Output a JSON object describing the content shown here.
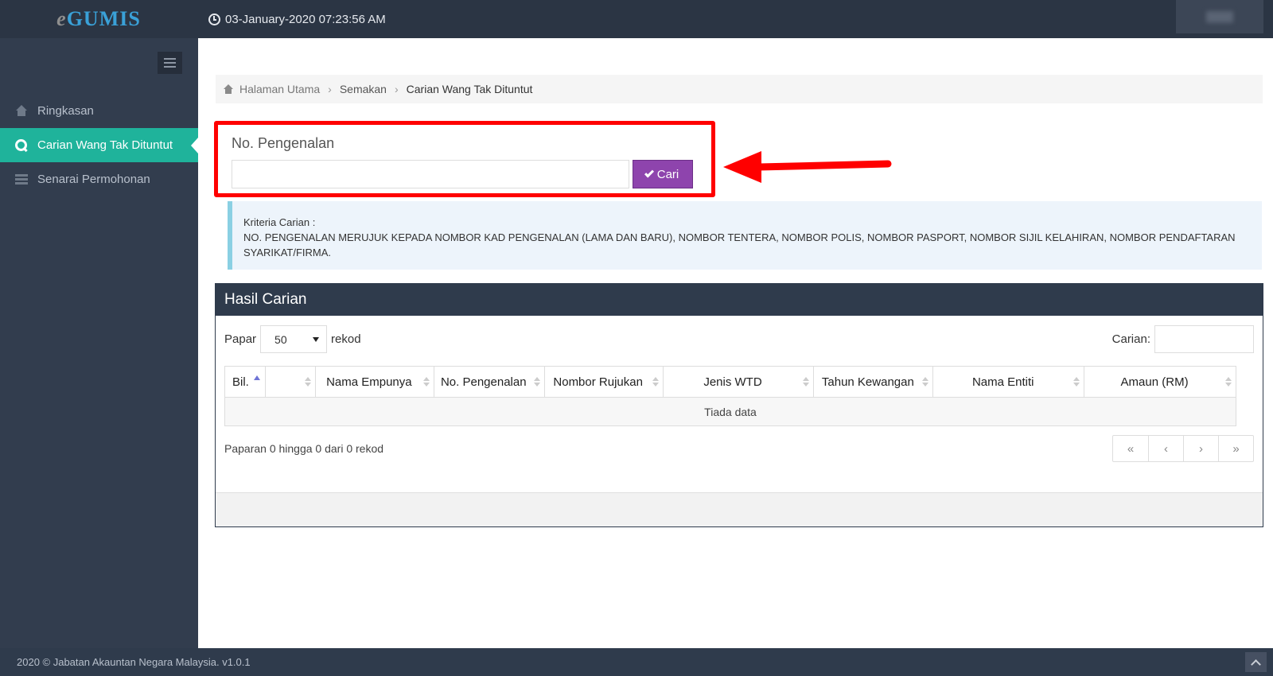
{
  "app": {
    "logo_e": "e",
    "logo_rest": "GUMIS",
    "datetime": "03-January-2020 07:23:56 AM"
  },
  "sidebar": {
    "items": [
      {
        "label": "Ringkasan",
        "icon": "home-icon"
      },
      {
        "label": "Carian Wang Tak Dituntut",
        "icon": "search-icon",
        "active": true
      },
      {
        "label": "Senarai Permohonan",
        "icon": "list-icon"
      }
    ]
  },
  "breadcrumb": [
    "Halaman Utama",
    "Semakan",
    "Carian Wang Tak Dituntut"
  ],
  "search": {
    "label": "No. Pengenalan",
    "value": "",
    "button_label": "Cari"
  },
  "info": {
    "title": "Kriteria Carian :",
    "text": "NO. PENGENALAN MERUJUK KEPADA NOMBOR KAD PENGENALAN (LAMA DAN BARU), NOMBOR TENTERA, NOMBOR POLIS, NOMBOR PASPORT, NOMBOR SIJIL KELAHIRAN, NOMBOR PENDAFTARAN SYARIKAT/FIRMA."
  },
  "results": {
    "title": "Hasil Carian",
    "length_prefix": "Papar",
    "length_value": "50",
    "length_suffix": "rekod",
    "filter_label": "Carian:",
    "columns": [
      "Bil.",
      "",
      "Nama Empunya",
      "No. Pengenalan",
      "Nombor Rujukan",
      "Jenis WTD",
      "Tahun Kewangan",
      "Nama Entiti",
      "Amaun (RM)"
    ],
    "empty_text": "Tiada data",
    "info_text": "Paparan 0 hingga 0 dari 0 rekod",
    "pager": [
      "«",
      "‹",
      "›",
      "»"
    ]
  },
  "footer": {
    "text": "2020 © Jabatan Akauntan Negara Malaysia. v1.0.1"
  },
  "colors": {
    "sidebar_bg": "#323d4e",
    "active_item": "#1fb39b",
    "button": "#8e44ad",
    "highlight": "#ff0000"
  }
}
